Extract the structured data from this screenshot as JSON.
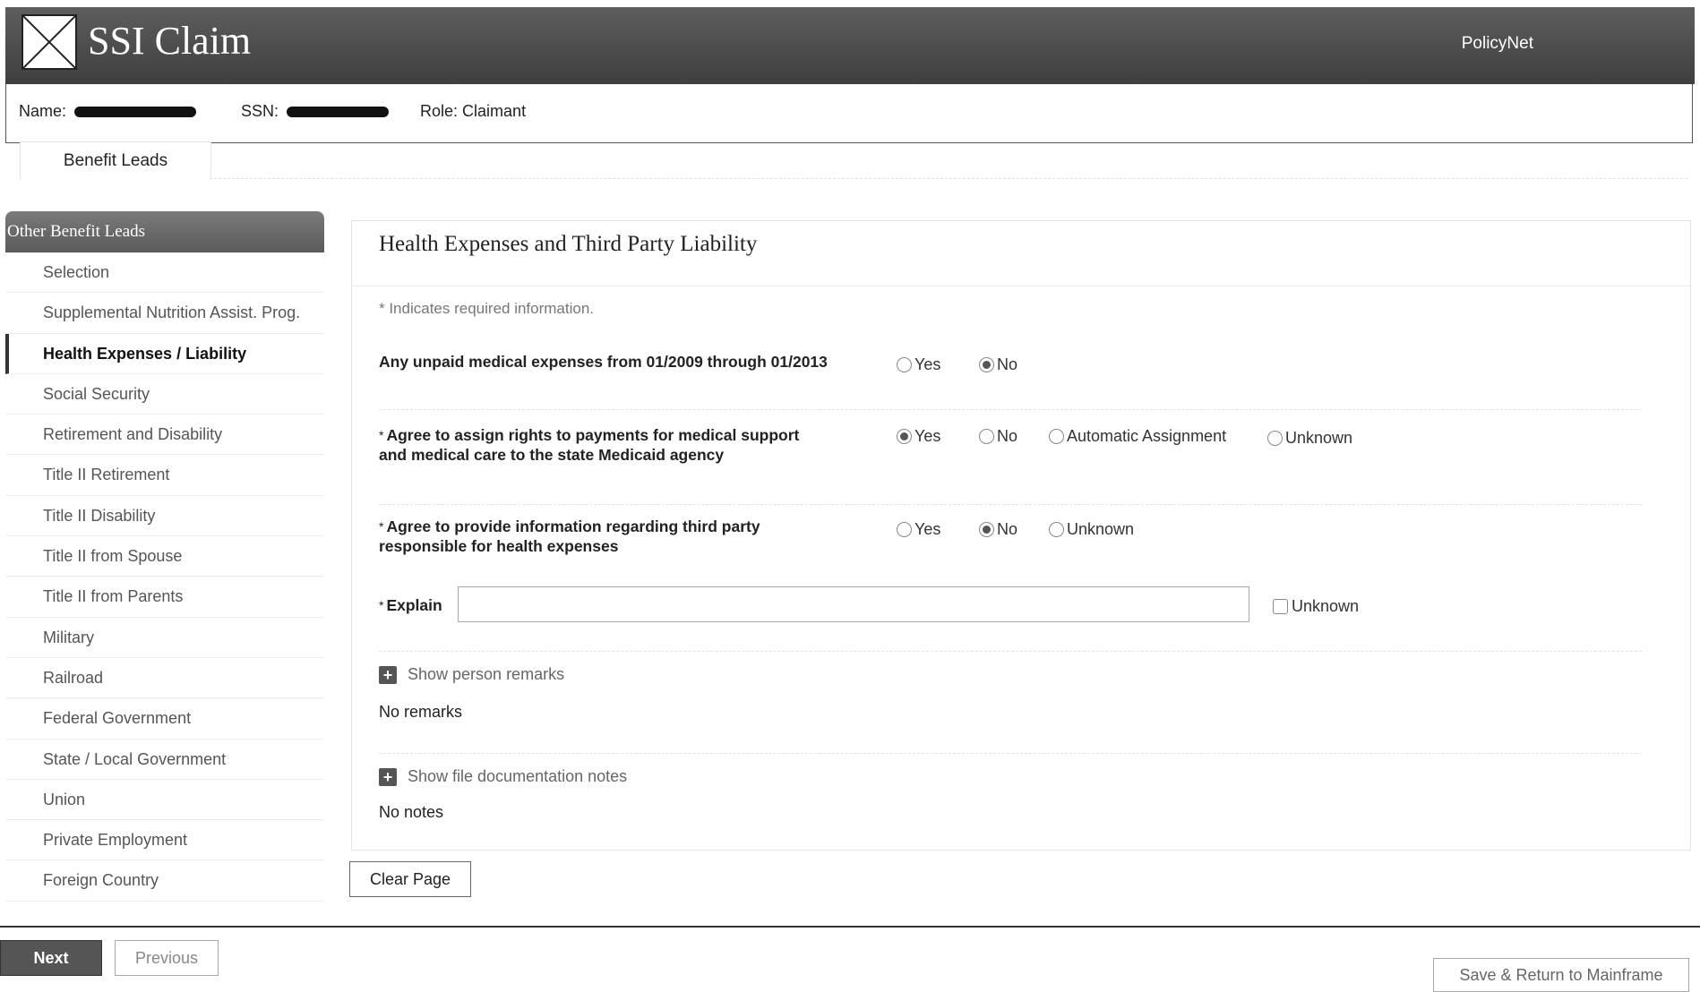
{
  "header": {
    "app_title": "SSI Claim",
    "policynet_link": "PolicyNet"
  },
  "claimant": {
    "name_label": "Name:",
    "ssn_label": "SSN:",
    "role_label": "Role:",
    "role_value": "Claimant"
  },
  "tabs": [
    {
      "label": "Benefit Leads"
    }
  ],
  "sidebar": {
    "title": "Other Benefit Leads",
    "items": [
      {
        "label": "Selection"
      },
      {
        "label": "Supplemental Nutrition Assist. Prog."
      },
      {
        "label": "Health Expenses / Liability",
        "active": true
      },
      {
        "label": "Social Security"
      },
      {
        "label": "Retirement and Disability"
      },
      {
        "label": "Title II Retirement"
      },
      {
        "label": "Title II Disability"
      },
      {
        "label": "Title II from Spouse"
      },
      {
        "label": "Title II from Parents"
      },
      {
        "label": "Military"
      },
      {
        "label": "Railroad"
      },
      {
        "label": "Federal Government"
      },
      {
        "label": "State / Local Government"
      },
      {
        "label": "Union"
      },
      {
        "label": "Private Employment"
      },
      {
        "label": "Foreign Country"
      }
    ]
  },
  "main": {
    "title": "Health Expenses and Third Party Liability",
    "required_note": "* Indicates required information.",
    "questions": [
      {
        "line1": "Any unpaid medical expenses from 01/2009 through 01/2013",
        "required": false,
        "options": [
          "Yes",
          "No"
        ],
        "selected": "No"
      },
      {
        "line1": "Agree to assign rights to payments for medical support",
        "line2": "and medical care to the state Medicaid agency",
        "required": true,
        "options": [
          "Yes",
          "No",
          "Automatic Assignment",
          "Unknown"
        ],
        "selected": "Yes"
      },
      {
        "line1": "Agree to  provide information regarding third party",
        "line2": "responsible for health expenses",
        "required": true,
        "options": [
          "Yes",
          "No",
          "Unknown"
        ],
        "selected": "No"
      }
    ],
    "explain": {
      "label": "Explain",
      "value": "",
      "unknown_label": "Unknown",
      "unknown_checked": false
    },
    "remarks_toggle": "Show person remarks",
    "remarks_text": "No remarks",
    "notes_toggle": "Show file documentation notes",
    "notes_text": "No notes"
  },
  "buttons": {
    "clear": "Clear Page",
    "next": "Next",
    "previous": "Previous",
    "save": "Save & Return to Mainframe"
  },
  "colors": {
    "header_bg": "#4a4a4a",
    "sidebar_head_bg": "#666666",
    "next_button_bg": "#555555"
  }
}
